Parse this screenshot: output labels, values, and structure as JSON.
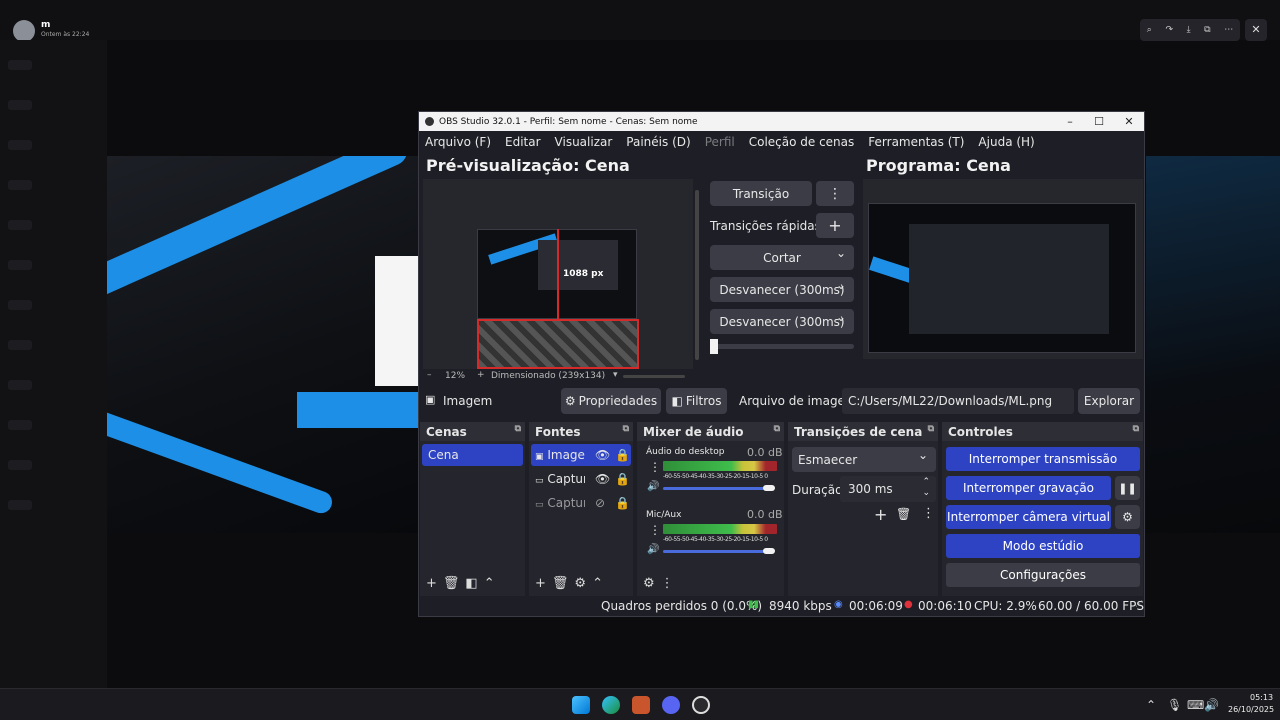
{
  "viewer": {
    "user": "m",
    "time": "Ontem às 22:24",
    "colors": {
      "accent_blue": "#1e8fe6"
    }
  },
  "obs": {
    "title": "OBS Studio 32.0.1 - Perfil: Sem nome - Cenas: Sem nome",
    "menu": [
      "Arquivo (F)",
      "Editar",
      "Visualizar",
      "Painéis (D)",
      "Perfil",
      "Coleção de cenas",
      "Ferramentas (T)",
      "Ajuda (H)"
    ],
    "preview_title": "Pré-visualização: Cena",
    "program_title": "Programa: Cena",
    "preview_dim": "1088 px",
    "zoom": "12%",
    "dimension_info": "Dimensionado (239x134)",
    "transition_btn": "Transição",
    "quick_transitions": "Transições rápidas",
    "cut": "Cortar",
    "fade1": "Desvanecer (300ms)",
    "fade2": "Desvanecer (300ms)",
    "source_bar": {
      "name": "Imagem",
      "properties": "Propriedades",
      "filters": "Filtros",
      "file_label": "Arquivo de imagem",
      "file_path": "C:/Users/ML22/Downloads/ML.png",
      "browse": "Explorar"
    },
    "scenes": {
      "title": "Cenas",
      "items": [
        "Cena"
      ]
    },
    "sources": {
      "title": "Fontes",
      "items": [
        "Imagem",
        "Captura",
        "Captura"
      ]
    },
    "mixer": {
      "title": "Mixer de áudio",
      "channels": [
        {
          "name": "Áudio do desktop",
          "db": "0.0 dB"
        },
        {
          "name": "Mic/Aux",
          "db": "0.0 dB"
        }
      ],
      "scale": "-60-55-50-45-40-35-30-25-20-15-10-5 0"
    },
    "transitions": {
      "title": "Transições de cena",
      "selected": "Esmaecer",
      "duration_label": "Duração",
      "duration": "300 ms"
    },
    "controls": {
      "title": "Controles",
      "stop_stream": "Interromper transmissão",
      "stop_record": "Interromper gravação",
      "stop_vcam": "Interromper câmera virtual",
      "studio_mode": "Modo estúdio",
      "settings": "Configurações"
    },
    "status": {
      "dropped": "Quadros perdidos 0 (0.0%)",
      "bitrate": "8940 kbps",
      "stream_time": "00:06:09",
      "rec_time": "00:06:10",
      "cpu": "CPU: 2.9%",
      "fps": "60.00 / 60.00 FPS"
    }
  },
  "taskbar": {
    "time": "05:13",
    "date": "26/10/2025"
  }
}
